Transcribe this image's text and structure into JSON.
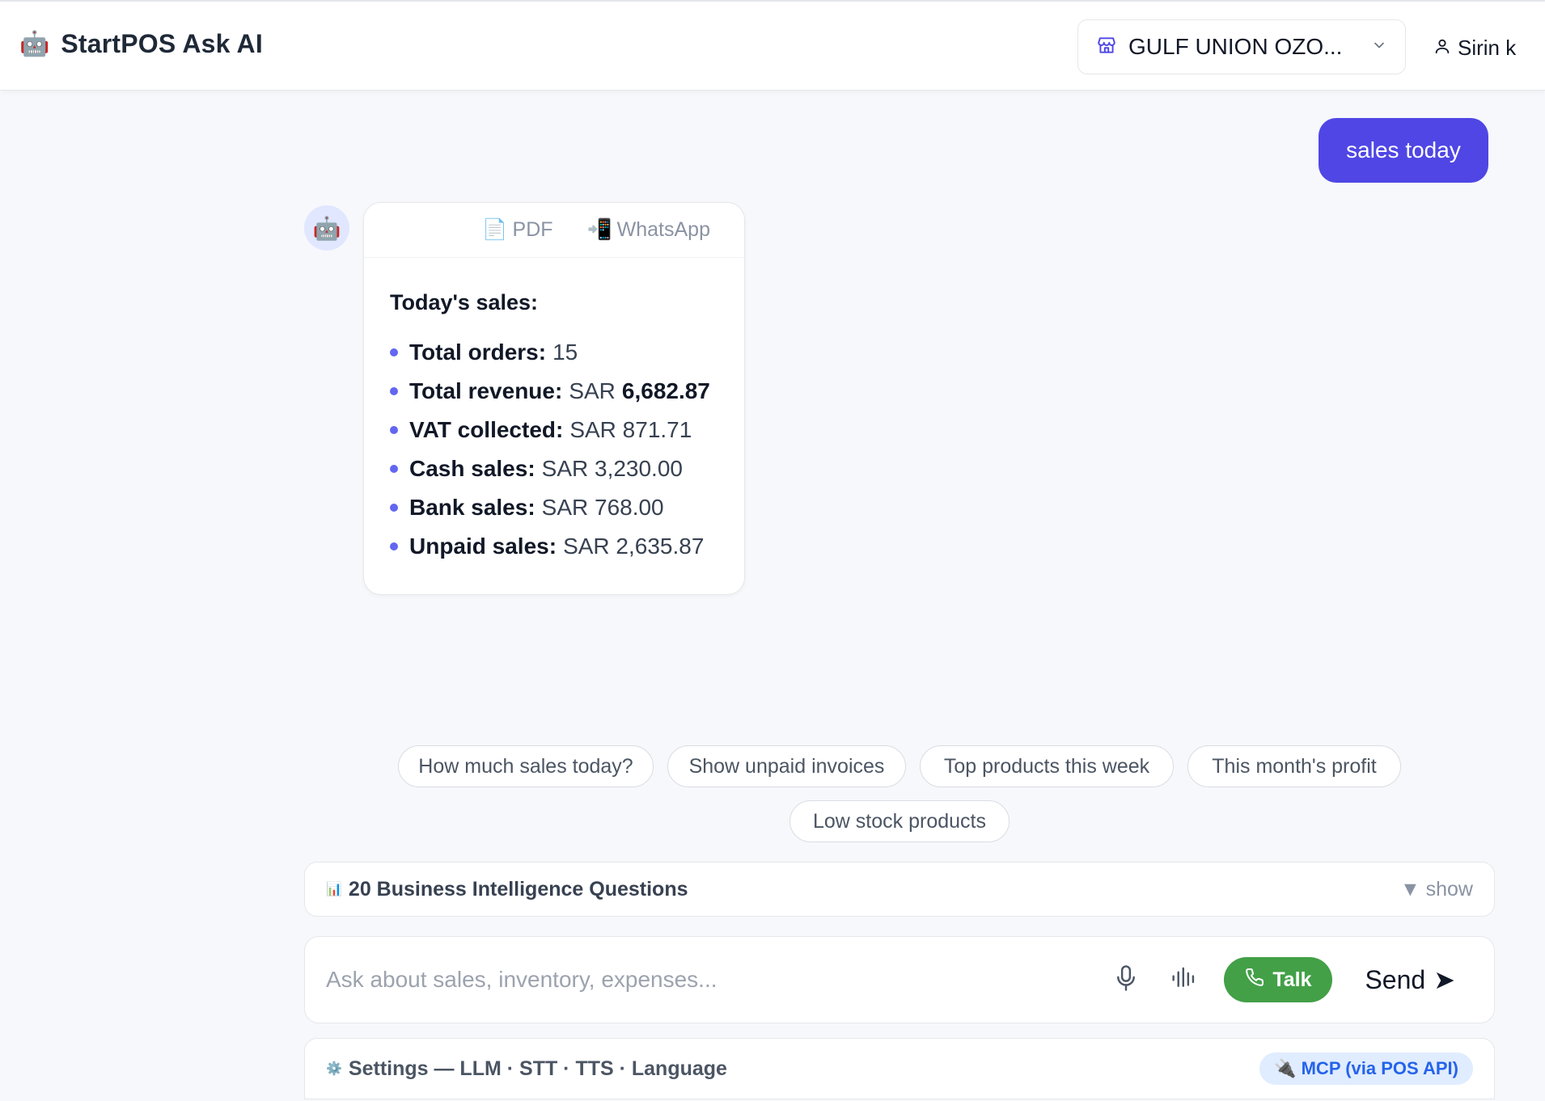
{
  "header": {
    "app_icon": "🤖",
    "app_title": "StartPOS Ask AI",
    "store_selector": {
      "icon": "store-icon",
      "value": "GULF UNION OZO..."
    },
    "user": {
      "icon": "user-icon",
      "name": "Sirin k"
    }
  },
  "chat": {
    "user_message": "sales today",
    "bot_reply": {
      "avatar": "🤖",
      "actions": [
        {
          "icon": "📄",
          "label": "PDF"
        },
        {
          "icon": "📲",
          "label": "WhatsApp"
        }
      ],
      "heading": "Today's sales:",
      "items": [
        {
          "label": "Total orders:",
          "value": "15",
          "strong_value": ""
        },
        {
          "label": "Total revenue:",
          "value": "SAR",
          "strong_value": "6,682.87"
        },
        {
          "label": "VAT collected:",
          "value": "SAR 871.71",
          "strong_value": ""
        },
        {
          "label": "Cash sales:",
          "value": "SAR 3,230.00",
          "strong_value": ""
        },
        {
          "label": "Bank sales:",
          "value": "SAR 768.00",
          "strong_value": ""
        },
        {
          "label": "Unpaid sales:",
          "value": "SAR 2,635.87",
          "strong_value": ""
        }
      ]
    }
  },
  "suggestions": [
    "How much sales today?",
    "Show unpaid invoices",
    "Top products this week",
    "This month's profit",
    "Low stock products"
  ],
  "bi_questions": {
    "icon": "📊",
    "title": "20 Business Intelligence Questions",
    "toggle": "▼ show"
  },
  "composer": {
    "placeholder": "Ask about sales, inventory, expenses...",
    "value": "",
    "mic_icon": "microphone-icon",
    "wave_icon": "waveform-icon",
    "talk_label": "Talk",
    "send_label": "Send",
    "send_arrow": "➤"
  },
  "settings": {
    "icon": "⚙️",
    "label": "Settings — LLM · STT · TTS · Language",
    "mcp_icon": "🔌",
    "mcp_label": "MCP (via POS API)"
  },
  "colors": {
    "accent": "#4f46e5",
    "talk_green": "#43a047",
    "bullet": "#6366f1",
    "mcp_badge_bg": "#e0ecff",
    "mcp_badge_text": "#2563eb",
    "page_bg": "#f7f8fb"
  }
}
